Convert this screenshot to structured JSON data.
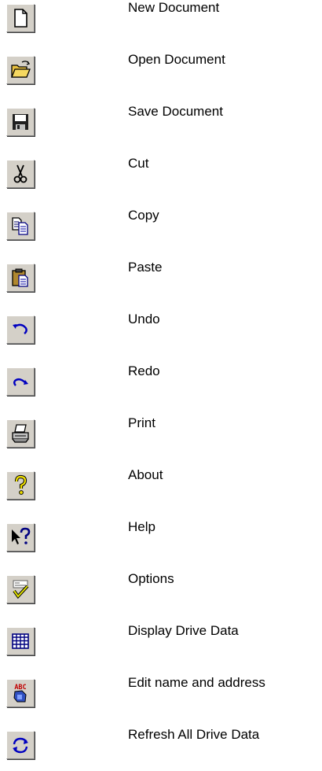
{
  "toolbar_legend": [
    {
      "icon": "new-document-icon",
      "label": "New Document"
    },
    {
      "icon": "open-folder-icon",
      "label": "Open Document"
    },
    {
      "icon": "floppy-disk-icon",
      "label": "Save Document"
    },
    {
      "icon": "scissors-icon",
      "label": "Cut"
    },
    {
      "icon": "copy-icon",
      "label": "Copy"
    },
    {
      "icon": "clipboard-paste-icon",
      "label": "Paste"
    },
    {
      "icon": "undo-arrow-icon",
      "label": "Undo"
    },
    {
      "icon": "redo-arrow-icon",
      "label": "Redo"
    },
    {
      "icon": "printer-icon",
      "label": "Print"
    },
    {
      "icon": "question-mark-icon",
      "label": "About"
    },
    {
      "icon": "help-pointer-icon",
      "label": "Help"
    },
    {
      "icon": "options-checkmark-icon",
      "label": "Options"
    },
    {
      "icon": "grid-table-icon",
      "label": "Display Drive Data"
    },
    {
      "icon": "abc-edit-icon",
      "label": "Edit name and address"
    },
    {
      "icon": "refresh-arrows-icon",
      "label": "Refresh All Drive Data"
    }
  ]
}
